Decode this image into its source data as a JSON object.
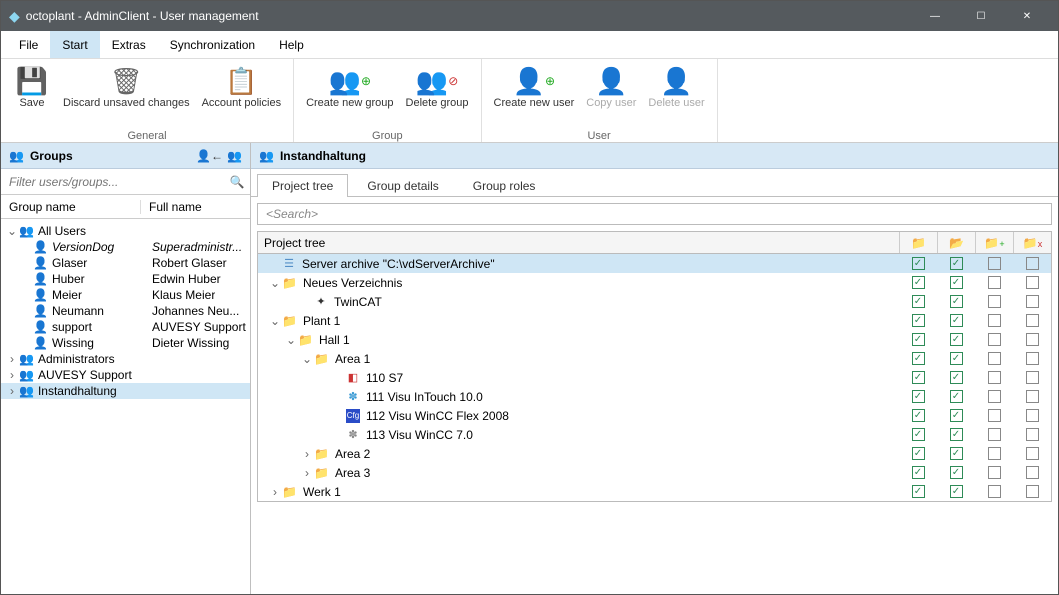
{
  "window": {
    "title": "octoplant - AdminClient - User management"
  },
  "menu": {
    "file": "File",
    "start": "Start",
    "extras": "Extras",
    "sync": "Synchronization",
    "help": "Help"
  },
  "ribbon": {
    "save": "Save",
    "discard": "Discard\nunsaved changes",
    "policies": "Account\npolicies",
    "general": "General",
    "create_group": "Create new\ngroup",
    "delete_group": "Delete\ngroup",
    "group": "Group",
    "create_user": "Create new\nuser",
    "copy_user": "Copy\nuser",
    "delete_user": "Delete\nuser",
    "user": "User"
  },
  "left": {
    "title": "Groups",
    "filter_placeholder": "Filter users/groups...",
    "col_group": "Group name",
    "col_full": "Full name",
    "tree": {
      "all_users": "All Users",
      "users": [
        {
          "g": "VersionDog",
          "f": "Superadministr...",
          "italic": true
        },
        {
          "g": "Glaser",
          "f": "Robert Glaser"
        },
        {
          "g": "Huber",
          "f": "Edwin Huber"
        },
        {
          "g": "Meier",
          "f": "Klaus Meier"
        },
        {
          "g": "Neumann",
          "f": "Johannes Neu..."
        },
        {
          "g": "support",
          "f": "AUVESY Support"
        },
        {
          "g": "Wissing",
          "f": "Dieter Wissing"
        }
      ],
      "groups_after": [
        "Administrators",
        "AUVESY Support",
        "Instandhaltung"
      ],
      "selected_group_idx": 2
    }
  },
  "right": {
    "header": "Instandhaltung",
    "tabs": {
      "pt": "Project tree",
      "gd": "Group details",
      "gr": "Group roles"
    },
    "search_placeholder": "<Search>",
    "tree_header": "Project tree",
    "rows": [
      {
        "indent": 0,
        "twist": "",
        "icon": "server",
        "label": "Server archive \"C:\\vdServerArchive\"",
        "c": [
          true,
          true,
          false,
          false
        ],
        "selected": true
      },
      {
        "indent": 0,
        "twist": "v",
        "icon": "folder",
        "label": "Neues Verzeichnis",
        "c": [
          true,
          true,
          false,
          false
        ]
      },
      {
        "indent": 2,
        "twist": "",
        "icon": "twincat",
        "label": "TwinCAT",
        "c": [
          true,
          true,
          false,
          false
        ]
      },
      {
        "indent": 0,
        "twist": "v",
        "icon": "folder",
        "label": "Plant 1",
        "c": [
          true,
          true,
          false,
          false
        ]
      },
      {
        "indent": 1,
        "twist": "v",
        "icon": "folder",
        "label": "Hall 1",
        "c": [
          true,
          true,
          false,
          false
        ]
      },
      {
        "indent": 2,
        "twist": "v",
        "icon": "folder",
        "label": "Area 1",
        "c": [
          true,
          true,
          false,
          false
        ]
      },
      {
        "indent": 4,
        "twist": "",
        "icon": "s7",
        "label": "110 S7",
        "c": [
          true,
          true,
          false,
          false
        ]
      },
      {
        "indent": 4,
        "twist": "",
        "icon": "intouch",
        "label": "111 Visu InTouch 10.0",
        "c": [
          true,
          true,
          false,
          false
        ]
      },
      {
        "indent": 4,
        "twist": "",
        "icon": "wincc",
        "label": "112 Visu WinCC Flex 2008",
        "c": [
          true,
          true,
          false,
          false
        ]
      },
      {
        "indent": 4,
        "twist": "",
        "icon": "wincc7",
        "label": "113 Visu WinCC 7.0",
        "c": [
          true,
          true,
          false,
          false
        ]
      },
      {
        "indent": 2,
        "twist": ">",
        "icon": "folder",
        "label": "Area 2",
        "c": [
          true,
          true,
          false,
          false
        ]
      },
      {
        "indent": 2,
        "twist": ">",
        "icon": "folder",
        "label": "Area 3",
        "c": [
          true,
          true,
          false,
          false
        ]
      },
      {
        "indent": 0,
        "twist": ">",
        "icon": "folder",
        "label": "Werk 1",
        "c": [
          true,
          true,
          false,
          false
        ]
      }
    ]
  }
}
